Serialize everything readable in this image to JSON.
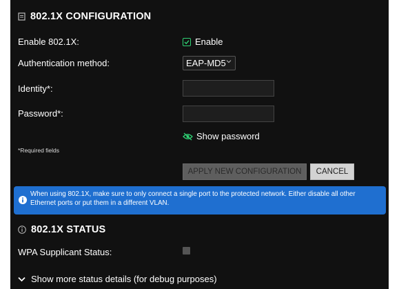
{
  "config": {
    "title": "802.1X CONFIGURATION",
    "enable_label": "Enable 802.1X:",
    "enable_checkbox_label": "Enable",
    "auth_label": "Authentication method:",
    "auth_value": "EAP-MD5",
    "identity_label": "Identity*:",
    "identity_value": "",
    "password_label": "Password*:",
    "password_value": "",
    "show_password_label": "Show password",
    "required_note": "*Required fields",
    "apply_label": "APPLY NEW CONFIGURATION",
    "cancel_label": "CANCEL",
    "info_text": "When using 802.1X, make sure to only connect a single port to the protected network. Either disable all other Ethernet ports or put them in a different VLAN."
  },
  "status": {
    "title": "802.1X STATUS",
    "wpa_label": "WPA Supplicant Status:",
    "more_label": "Show more status details (for debug purposes)"
  },
  "icons": {
    "config_icon": "document-icon",
    "checkbox_icon": "checkmark-icon",
    "show_password_icon": "eye-slash-icon",
    "info_icon": "info-icon",
    "status_icon": "info-circle-icon",
    "more_icon": "chevron-down-icon"
  },
  "colors": {
    "panel_bg": "#111111",
    "accent_green": "#2fd174",
    "info_blue": "#1f6fd0"
  }
}
